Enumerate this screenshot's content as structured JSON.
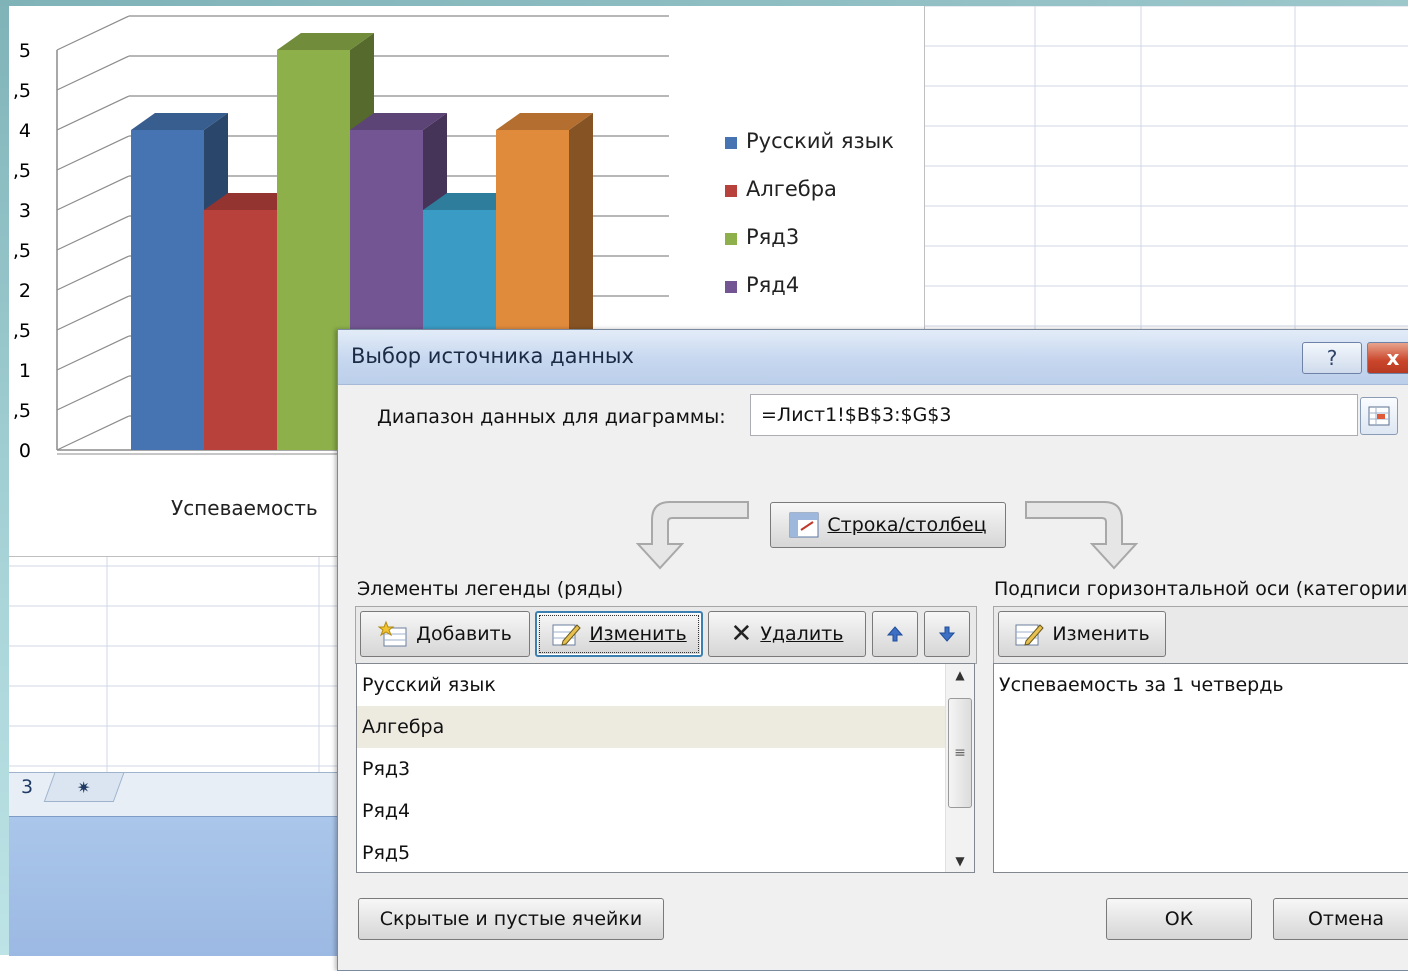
{
  "chart": {
    "y_ticks": [
      "5",
      ",5",
      "4",
      ",5",
      "3",
      ",5",
      "2",
      ",5",
      "1",
      ",5",
      "0"
    ],
    "category_label": "Успеваемость",
    "legend": [
      {
        "label": "Русский язык",
        "color": "#4674b3"
      },
      {
        "label": "Алгебра",
        "color": "#b9413c"
      },
      {
        "label": "Ряд3",
        "color": "#8db04a"
      },
      {
        "label": "Ряд4",
        "color": "#735593"
      }
    ]
  },
  "sheet_tabs": {
    "tab_partial": "3"
  },
  "dialog": {
    "title": "Выбор источника данных",
    "range_label": "Диапазон данных для диаграммы:",
    "range_value": "=Лист1!$B$3:$G$3",
    "switch_button": "Строка/столбец",
    "legend_section_label": "Элементы легенды (ряды)",
    "axis_section_label": "Подписи горизонтальной оси (категории",
    "add_button": "Добавить",
    "edit_button": "Изменить",
    "delete_button": "Удалить",
    "axis_edit_button": "Изменить",
    "series": [
      "Русский язык",
      "Алгебра",
      "Ряд3",
      "Ряд4",
      "Ряд5"
    ],
    "selected_series": "Алгебра",
    "categories": [
      "Успеваемость за 1 четвердь"
    ],
    "hidden_cells_button": "Скрытые и пустые ячейки",
    "ok_button": "ОК",
    "cancel_button": "Отмена",
    "help_button": "?",
    "close_button": "x"
  },
  "chart_data": {
    "type": "bar",
    "categories": [
      "Успеваемость"
    ],
    "ylim": [
      0,
      5
    ],
    "series": [
      {
        "name": "Русский язык",
        "values": [
          4
        ],
        "color": "#4674b3"
      },
      {
        "name": "Алгебра",
        "values": [
          3
        ],
        "color": "#b9413c"
      },
      {
        "name": "Ряд3",
        "values": [
          5
        ],
        "color": "#8db04a"
      },
      {
        "name": "Ряд4",
        "values": [
          4
        ],
        "color": "#735593"
      },
      {
        "name": "Ряд5",
        "values": [
          3
        ],
        "color": "#3a9cc4"
      },
      {
        "name": "",
        "values": [
          4
        ],
        "color": "#e08a3c"
      }
    ]
  }
}
